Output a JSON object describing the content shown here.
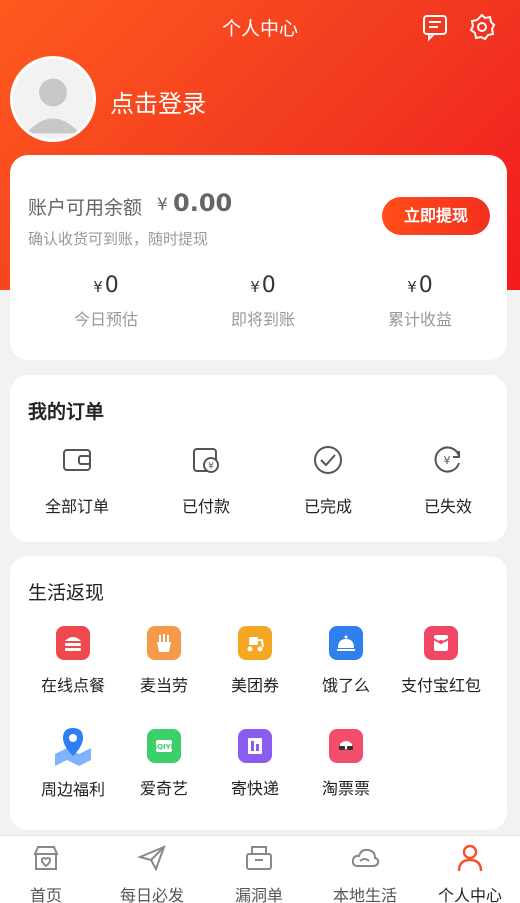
{
  "header": {
    "title": "个人中心",
    "message_icon": "message-icon",
    "settings_icon": "gear-icon"
  },
  "profile": {
    "login_text": "点击登录"
  },
  "balance": {
    "label": "账户可用余额",
    "currency": "¥",
    "amount": "0.00",
    "subtitle": "确认收货可到账，随时提现",
    "withdraw_label": "立即提现",
    "stats": [
      {
        "currency": "¥",
        "value": "0",
        "label": "今日预估"
      },
      {
        "currency": "¥",
        "value": "0",
        "label": "即将到账"
      },
      {
        "currency": "¥",
        "value": "0",
        "label": "累计收益"
      }
    ]
  },
  "orders": {
    "title": "我的订单",
    "items": [
      {
        "label": "全部订单",
        "icon": "wallet-icon"
      },
      {
        "label": "已付款",
        "icon": "paid-icon"
      },
      {
        "label": "已完成",
        "icon": "check-icon"
      },
      {
        "label": "已失效",
        "icon": "expired-icon"
      }
    ]
  },
  "life": {
    "title": "生活返现",
    "items": [
      {
        "label": "在线点餐",
        "icon": "burger-icon",
        "color": "#f0484f"
      },
      {
        "label": "麦当劳",
        "icon": "fries-icon",
        "color": "#f59a4a"
      },
      {
        "label": "美团券",
        "icon": "scooter-icon",
        "color": "#f5a623"
      },
      {
        "label": "饿了么",
        "icon": "cloche-icon",
        "color": "#2f80ed"
      },
      {
        "label": "支付宝红包",
        "icon": "red-envelope-icon",
        "color": "#f04864"
      },
      {
        "label": "周边福利",
        "icon": "map-pin-icon",
        "color": "#2d7ef7"
      },
      {
        "label": "爱奇艺",
        "icon": "iqiyi-icon",
        "color": "#3ccf6a"
      },
      {
        "label": "寄快递",
        "icon": "parcel-icon",
        "color": "#8a5cf0"
      },
      {
        "label": "淘票票",
        "icon": "movie-glasses-icon",
        "color": "#f24e6c"
      }
    ]
  },
  "tabbar": {
    "items": [
      {
        "label": "首页",
        "icon": "home-shop-icon"
      },
      {
        "label": "每日必发",
        "icon": "paper-plane-icon"
      },
      {
        "label": "漏洞单",
        "icon": "box-icon"
      },
      {
        "label": "本地生活",
        "icon": "cloud-icon"
      },
      {
        "label": "个人中心",
        "icon": "user-icon",
        "active": true
      }
    ],
    "active_color": "#f2522e"
  }
}
